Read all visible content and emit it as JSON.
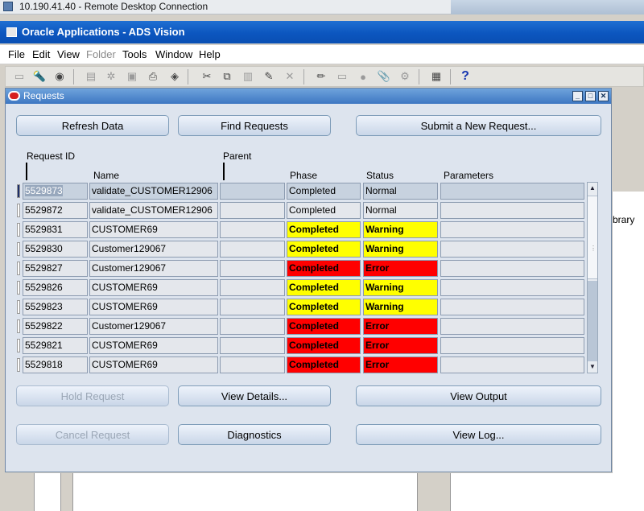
{
  "rdp": {
    "title": "10.190.41.40 - Remote Desktop Connection"
  },
  "app": {
    "title": "Oracle Applications - ADS Vision"
  },
  "menu": {
    "items": [
      {
        "label": "File",
        "disabled": false
      },
      {
        "label": "Edit",
        "disabled": false
      },
      {
        "label": "View",
        "disabled": false
      },
      {
        "label": "Folder",
        "disabled": true
      },
      {
        "label": "Tools",
        "disabled": false
      },
      {
        "label": "Window",
        "disabled": false
      },
      {
        "label": "Help",
        "disabled": false
      }
    ]
  },
  "toolbar": {
    "icons": [
      "new-icon",
      "find-icon",
      "navigator-icon",
      "save-icon",
      "switch-responsibility-icon",
      "print-icon",
      "close-form-icon",
      "paste-icon",
      "cut-icon",
      "copy-icon",
      "paste-special-icon",
      "new-record-icon",
      "delete-record-icon",
      "edit-field-icon",
      "zoom-icon",
      "translations-icon",
      "attachments-icon",
      "folder-tools-icon",
      "window-icon",
      "help-icon"
    ]
  },
  "background": {
    "side_label": "brary"
  },
  "requests_window": {
    "title": "Requests",
    "buttons": {
      "refresh": "Refresh Data",
      "find": "Find Requests",
      "submit": "Submit a New Request...",
      "hold": "Hold Request",
      "view_details": "View Details...",
      "view_output": "View Output",
      "cancel": "Cancel Request",
      "diagnostics": "Diagnostics",
      "view_log": "View Log..."
    },
    "columns": {
      "request_id": "Request ID",
      "parent": "Parent",
      "name": "Name",
      "phase": "Phase",
      "status": "Status",
      "parameters": "Parameters"
    },
    "rows": [
      {
        "id": "5529873",
        "name": "validate_CUSTOMER12906",
        "parent": "",
        "phase": "Completed",
        "status": "Normal",
        "parameters": "",
        "color": "normal",
        "selected": true
      },
      {
        "id": "5529872",
        "name": "validate_CUSTOMER12906",
        "parent": "",
        "phase": "Completed",
        "status": "Normal",
        "parameters": "",
        "color": "normal",
        "selected": false
      },
      {
        "id": "5529831",
        "name": "CUSTOMER69",
        "parent": "",
        "phase": "Completed",
        "status": "Warning",
        "parameters": "",
        "color": "yellow",
        "selected": false
      },
      {
        "id": "5529830",
        "name": "Customer129067",
        "parent": "",
        "phase": "Completed",
        "status": "Warning",
        "parameters": "",
        "color": "yellow",
        "selected": false
      },
      {
        "id": "5529827",
        "name": "Customer129067",
        "parent": "",
        "phase": "Completed",
        "status": "Error",
        "parameters": "",
        "color": "red",
        "selected": false
      },
      {
        "id": "5529826",
        "name": "CUSTOMER69",
        "parent": "",
        "phase": "Completed",
        "status": "Warning",
        "parameters": "",
        "color": "yellow",
        "selected": false
      },
      {
        "id": "5529823",
        "name": "CUSTOMER69",
        "parent": "",
        "phase": "Completed",
        "status": "Warning",
        "parameters": "",
        "color": "yellow",
        "selected": false
      },
      {
        "id": "5529822",
        "name": "Customer129067",
        "parent": "",
        "phase": "Completed",
        "status": "Error",
        "parameters": "",
        "color": "red",
        "selected": false
      },
      {
        "id": "5529821",
        "name": "CUSTOMER69",
        "parent": "",
        "phase": "Completed",
        "status": "Error",
        "parameters": "",
        "color": "red",
        "selected": false
      },
      {
        "id": "5529818",
        "name": "CUSTOMER69",
        "parent": "",
        "phase": "Completed",
        "status": "Error",
        "parameters": "",
        "color": "red",
        "selected": false
      }
    ]
  },
  "colors": {
    "warning": "#ffff00",
    "error": "#ff0000",
    "title_bar": "#0c56bf"
  }
}
